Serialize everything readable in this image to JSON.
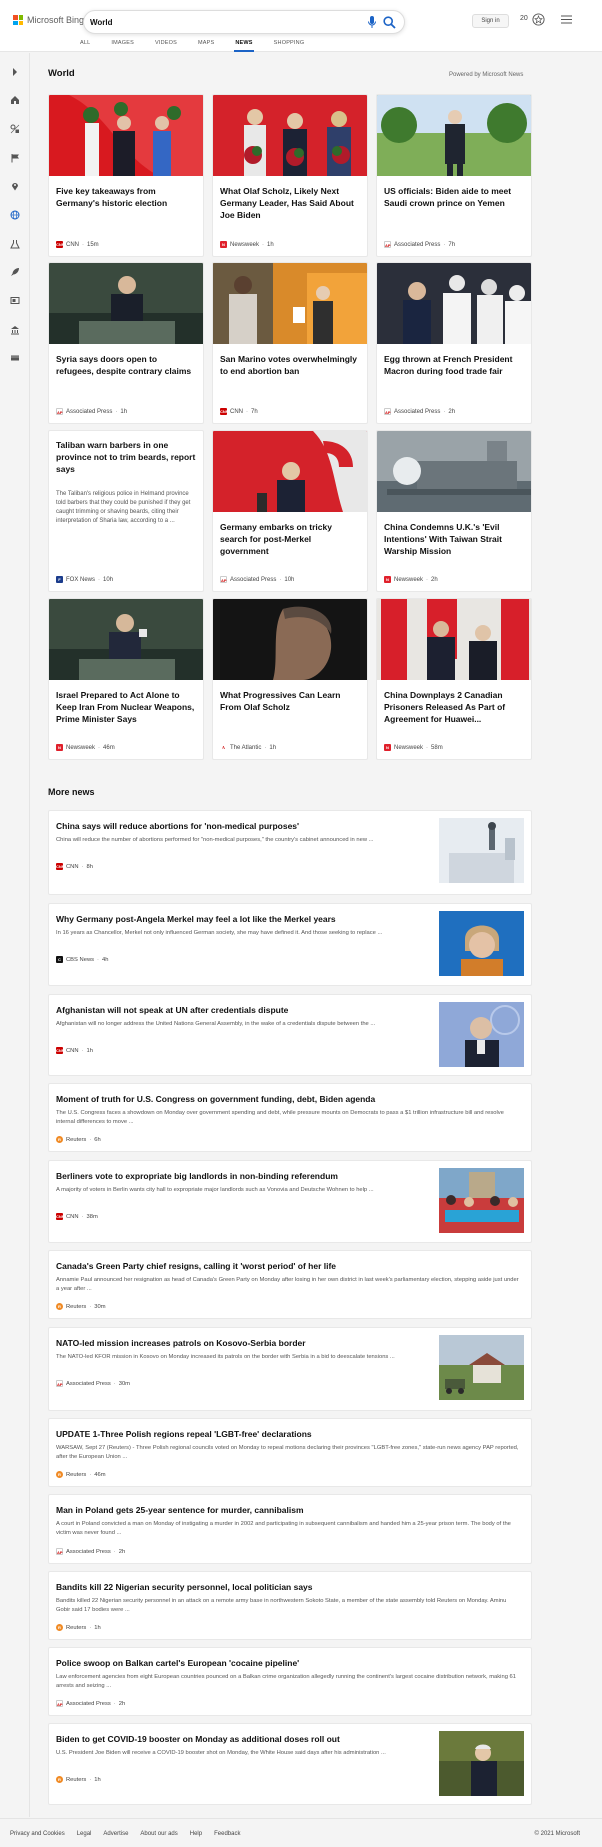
{
  "brand": {
    "name": "Microsoft Bing",
    "colors": [
      "#f25022",
      "#7fba00",
      "#00a4ef",
      "#ffb900"
    ]
  },
  "search": {
    "query": "World"
  },
  "header": {
    "sign_in": "Sign in",
    "points": "20"
  },
  "tabs": [
    "ALL",
    "IMAGES",
    "VIDEOS",
    "MAPS",
    "NEWS",
    "SHOPPING"
  ],
  "active_tab": "NEWS",
  "sidebar_icons": [
    "expand-arrow-icon",
    "home-icon",
    "mixed-icon",
    "flag-icon",
    "location-pin-icon",
    "globe-icon",
    "science-icon",
    "rocket-icon",
    "monitor-icon",
    "building-icon",
    "film-icon"
  ],
  "section": {
    "title": "World",
    "powered_by": "Powered by Microsoft News"
  },
  "cards": [
    {
      "headline": "Five key takeaways from Germany's historic election",
      "source": "CNN",
      "time": "15m",
      "badge": "CNN",
      "badge_color": "#cc0000"
    },
    {
      "headline": "What Olaf Scholz, Likely Next Germany Leader, Has Said About Joe Biden",
      "source": "Newsweek",
      "time": "1h",
      "badge": "N",
      "badge_color": "#e0202b"
    },
    {
      "headline": "US officials: Biden aide to meet Saudi crown prince on Yemen",
      "source": "Associated Press",
      "time": "7h",
      "badge": "AP",
      "badge_color": "#ffffff"
    },
    {
      "headline": "Syria says doors open to refugees, despite contrary claims",
      "source": "Associated Press",
      "time": "1h",
      "badge": "AP",
      "badge_color": "#ffffff"
    },
    {
      "headline": "San Marino votes overwhelmingly to end abortion ban",
      "source": "CNN",
      "time": "7h",
      "badge": "CNN",
      "badge_color": "#cc0000"
    },
    {
      "headline": "Egg thrown at French President Macron during food trade fair",
      "source": "Associated Press",
      "time": "2h",
      "badge": "AP",
      "badge_color": "#ffffff"
    },
    {
      "headline": "Taliban warn barbers in one province not to trim beards, report says",
      "desc": "The Taliban's religious police in Helmand province told barbers that they could be punished if they get caught trimming or shaving beards, citing their interpretation of Sharia law, according to a ...",
      "source": "FOX News",
      "time": "10h",
      "badge": "F",
      "badge_color": "#1b3c8c"
    },
    {
      "headline": "Germany embarks on tricky search for post-Merkel government",
      "source": "Associated Press",
      "time": "10h",
      "badge": "AP",
      "badge_color": "#ffffff"
    },
    {
      "headline": "China Condemns U.K.'s 'Evil Intentions' With Taiwan Strait Warship Mission",
      "source": "Newsweek",
      "time": "2h",
      "badge": "N",
      "badge_color": "#e0202b"
    },
    {
      "headline": "Israel Prepared to Act Alone to Keep Iran From Nuclear Weapons, Prime Minister Says",
      "source": "Newsweek",
      "time": "46m",
      "badge": "N",
      "badge_color": "#e0202b"
    },
    {
      "headline": "What Progressives Can Learn From Olaf Scholz",
      "source": "The Atlantic",
      "time": "1h",
      "badge": "A",
      "badge_color": "#ffffff"
    },
    {
      "headline": "China Downplays 2 Canadian Prisoners Released As Part of Agreement for Huawei...",
      "source": "Newsweek",
      "time": "58m",
      "badge": "N",
      "badge_color": "#e0202b"
    }
  ],
  "more_news": {
    "title": "More news",
    "items": [
      {
        "headline": "China says will reduce abortions for 'non-medical purposes'",
        "desc": "China will reduce the number of abortions performed for \"non-medical purposes,\" the country's cabinet announced in new ...",
        "source": "CNN",
        "time": "8h",
        "badge": "CNN",
        "badge_color": "#cc0000"
      },
      {
        "headline": "Why Germany post-Angela Merkel may feel a lot like the Merkel years",
        "desc": "In 16 years as Chancellor, Merkel not only influenced German society, she may have defined it. And those seeking to replace ...",
        "source": "CBS News",
        "time": "4h",
        "badge": "C",
        "badge_color": "#111111"
      },
      {
        "headline": "Afghanistan will not speak at UN after credentials dispute",
        "desc": "Afghanistan will no longer address the United Nations General Assembly, in the wake of a credentials dispute between the ...",
        "source": "CNN",
        "time": "1h",
        "badge": "CNN",
        "badge_color": "#cc0000"
      },
      {
        "headline": "Moment of truth for U.S. Congress on government funding, debt, Biden agenda",
        "desc": "The U.S. Congress faces a showdown on Monday over government spending and debt, while pressure mounts on Democrats to pass a $1 trillion infrastructure bill and resolve internal differences to move ...",
        "source": "Reuters",
        "time": "6h",
        "badge": "R",
        "badge_color": "#f08a24"
      },
      {
        "headline": "Berliners vote to expropriate big landlords in non-binding referendum",
        "desc": "A majority of voters in Berlin wants city hall to expropriate major landlords such as Vonovia and Deutsche Wohnen to help ...",
        "source": "CNN",
        "time": "38m",
        "badge": "CNN",
        "badge_color": "#cc0000"
      },
      {
        "headline": "Canada's Green Party chief resigns, calling it 'worst period' of her life",
        "desc": "Annamie Paul announced her resignation as head of Canada's Green Party on Monday after losing in her own district in last week's parliamentary election, stepping aside just under a year after ...",
        "source": "Reuters",
        "time": "30m",
        "badge": "R",
        "badge_color": "#f08a24"
      },
      {
        "headline": "NATO-led mission increases patrols on Kosovo-Serbia border",
        "desc": "The NATO-led KFOR mission in Kosovo on Monday increased its patrols on the border with Serbia in a bid to deescalate tensions ...",
        "source": "Associated Press",
        "time": "30m",
        "badge": "AP",
        "badge_color": "#ffffff"
      },
      {
        "headline": "UPDATE 1-Three Polish regions repeal 'LGBT-free' declarations",
        "desc": "WARSAW, Sept 27 (Reuters) - Three Polish regional councils voted on Monday to repeal motions declaring their provinces \"LGBT-free zones,\" state-run news agency PAP reported, after the European Union ...",
        "source": "Reuters",
        "time": "46m",
        "badge": "R",
        "badge_color": "#f08a24"
      },
      {
        "headline": "Man in Poland gets 25-year sentence for murder, cannibalism",
        "desc": "A court in Poland convicted a man on Monday of instigating a murder in 2002 and participating in subsequent cannibalism and handed him a 25-year prison term. The body of the victim was never found ...",
        "source": "Associated Press",
        "time": "2h",
        "badge": "AP",
        "badge_color": "#ffffff"
      },
      {
        "headline": "Bandits kill 22 Nigerian security personnel, local politician says",
        "desc": "Bandits killed 22 Nigerian security personnel in an attack on a remote army base in northwestern Sokoto State, a member of the state assembly told Reuters on Monday. Aminu Gobir said 17 bodies were ...",
        "source": "Reuters",
        "time": "1h",
        "badge": "R",
        "badge_color": "#f08a24"
      },
      {
        "headline": "Police swoop on Balkan cartel's European 'cocaine pipeline'",
        "desc": "Law enforcement agencies from eight European countries pounced on a Balkan crime organization allegedly running the continent's largest cocaine distribution network, making 61 arrests and seizing ...",
        "source": "Associated Press",
        "time": "2h",
        "badge": "AP",
        "badge_color": "#ffffff"
      },
      {
        "headline": "Biden to get COVID-19 booster on Monday as additional doses roll out",
        "desc": "U.S. President Joe Biden will receive a COVID-19 booster shot on Monday, the White House said days after his administration ...",
        "source": "Reuters",
        "time": "1h",
        "badge": "R",
        "badge_color": "#f08a24"
      }
    ]
  },
  "footer": {
    "links": [
      "Privacy and Cookies",
      "Legal",
      "Advertise",
      "About our ads",
      "Help",
      "Feedback"
    ],
    "copyright": "© 2021 Microsoft"
  }
}
